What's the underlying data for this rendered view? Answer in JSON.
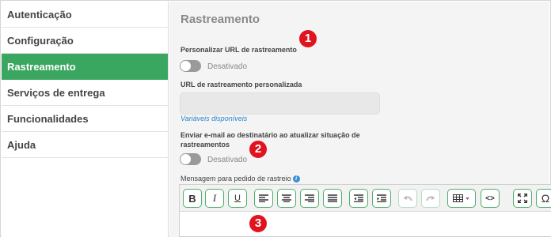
{
  "sidebar": {
    "items": [
      {
        "label": "Autenticação"
      },
      {
        "label": "Configuração"
      },
      {
        "label": "Rastreamento"
      },
      {
        "label": "Serviços de entrega"
      },
      {
        "label": "Funcionalidades"
      },
      {
        "label": "Ajuda"
      }
    ],
    "active_index": 2
  },
  "main": {
    "title": "Rastreamento",
    "custom_url_toggle": {
      "label": "Personalizar URL de rastreamento",
      "state_text": "Desativado"
    },
    "custom_url_field": {
      "label": "URL de rastreamento personalizada",
      "value": "",
      "placeholder": ""
    },
    "variables_link": "Variáveis disponíveis",
    "email_toggle": {
      "label_line1": "Enviar e-mail ao destinatário ao atualizar situação de",
      "label_line2": "rastreamentos",
      "state_text": "Desativado"
    },
    "message_label": "Mensagem para pedido de rastreio",
    "info_icon_glyph": "i"
  },
  "editor": {
    "toolbar": [
      {
        "name": "bold-icon",
        "glyph": "B"
      },
      {
        "name": "italic-icon",
        "glyph": "I"
      },
      {
        "name": "underline-icon",
        "glyph": "U"
      },
      {
        "name": "align-left-icon"
      },
      {
        "name": "align-center-icon"
      },
      {
        "name": "align-right-icon"
      },
      {
        "name": "align-justify-icon"
      },
      {
        "name": "outdent-icon"
      },
      {
        "name": "indent-icon"
      },
      {
        "name": "undo-icon",
        "disabled": true
      },
      {
        "name": "redo-icon",
        "disabled": true
      },
      {
        "name": "table-icon"
      },
      {
        "name": "source-code-icon",
        "glyph": "<>"
      },
      {
        "name": "fullscreen-icon"
      },
      {
        "name": "special-char-icon",
        "glyph": "Ω"
      }
    ],
    "body_text": ""
  },
  "markers": [
    "1",
    "2",
    "3"
  ],
  "colors": {
    "accent_green": "#3aa660",
    "marker_red": "#e0141e",
    "link_blue": "#2a86c8"
  }
}
